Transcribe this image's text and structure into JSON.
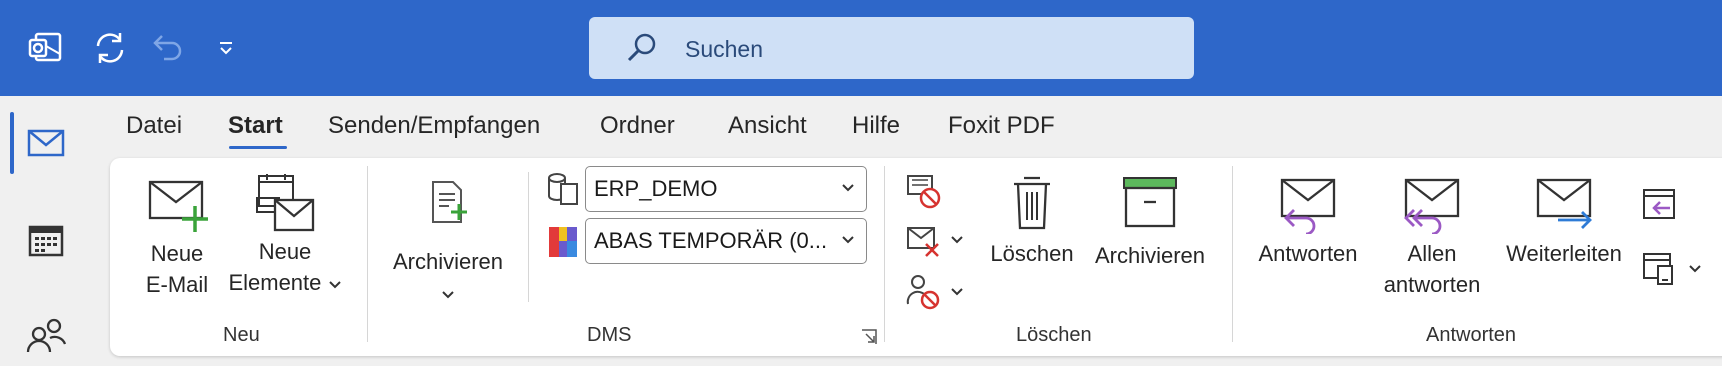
{
  "titlebar": {
    "search_placeholder": "Suchen"
  },
  "menu": {
    "tabs": [
      "Datei",
      "Start",
      "Senden/Empfangen",
      "Ordner",
      "Ansicht",
      "Hilfe",
      "Foxit PDF"
    ],
    "active_tab": "Start"
  },
  "ribbon": {
    "neu": {
      "group_label": "Neu",
      "new_email_line1": "Neue",
      "new_email_line2": "E-Mail",
      "new_items_line1": "Neue",
      "new_items_line2": "Elemente"
    },
    "dms": {
      "group_label": "DMS",
      "archive_label": "Archivieren",
      "combo1_value": "ERP_DEMO",
      "combo2_value": "ABAS TEMPORÄR (0..."
    },
    "loeschen": {
      "group_label": "Löschen",
      "delete_label": "Löschen",
      "archive_label": "Archivieren"
    },
    "antworten": {
      "group_label": "Antworten",
      "reply_label": "Antworten",
      "reply_all_line1": "Allen",
      "reply_all_line2": "antworten",
      "forward_label": "Weiterleiten"
    }
  },
  "colors": {
    "titlebar": "#2e67c9",
    "search_bg": "#cfe0f6",
    "accent": "#2e67c9",
    "reply_purple": "#9b59c4",
    "forward_blue": "#2e7bd6",
    "new_green": "#3aa33a",
    "delete_red": "#d6332f"
  }
}
